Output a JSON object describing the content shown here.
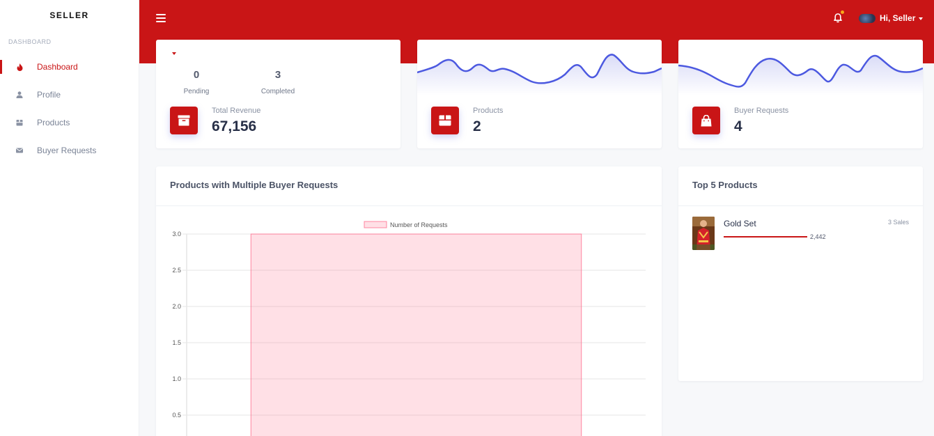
{
  "sidebar": {
    "brand": "SELLER",
    "section_label": "DASHBOARD",
    "items": [
      {
        "label": "Dashboard",
        "icon": "flame-icon",
        "active": true
      },
      {
        "label": "Profile",
        "icon": "user-icon",
        "active": false
      },
      {
        "label": "Products",
        "icon": "box-icon",
        "active": false
      },
      {
        "label": "Buyer Requests",
        "icon": "envelope-icon",
        "active": false
      }
    ]
  },
  "topbar": {
    "user_greeting": "Hi, Seller",
    "accent_color": "#c91516",
    "notification_dot_color": "#f7a71a"
  },
  "revenue_card": {
    "pending_value": "0",
    "pending_label": "Pending",
    "completed_value": "3",
    "completed_label": "Completed",
    "label": "Total Revenue",
    "value": "67,156"
  },
  "products_card": {
    "label": "Products",
    "value": "2"
  },
  "requests_card": {
    "label": "Buyer Requests",
    "value": "4"
  },
  "chart_panel": {
    "title": "Products with Multiple Buyer Requests"
  },
  "chart_data": {
    "type": "bar",
    "categories": [
      ""
    ],
    "series": [
      {
        "name": "Number of Requests",
        "values": [
          3
        ]
      }
    ],
    "ylim": [
      0,
      3
    ],
    "yticks": [
      "3.0",
      "2.5",
      "2.0",
      "1.5",
      "1.0",
      "0.5"
    ],
    "legend": "top",
    "grid": true,
    "bar_color": "#ff6384"
  },
  "top_products": {
    "title": "Top 5 Products",
    "items": [
      {
        "name": "Gold Set",
        "sales": "3 Sales",
        "amount": "2,442"
      }
    ]
  }
}
